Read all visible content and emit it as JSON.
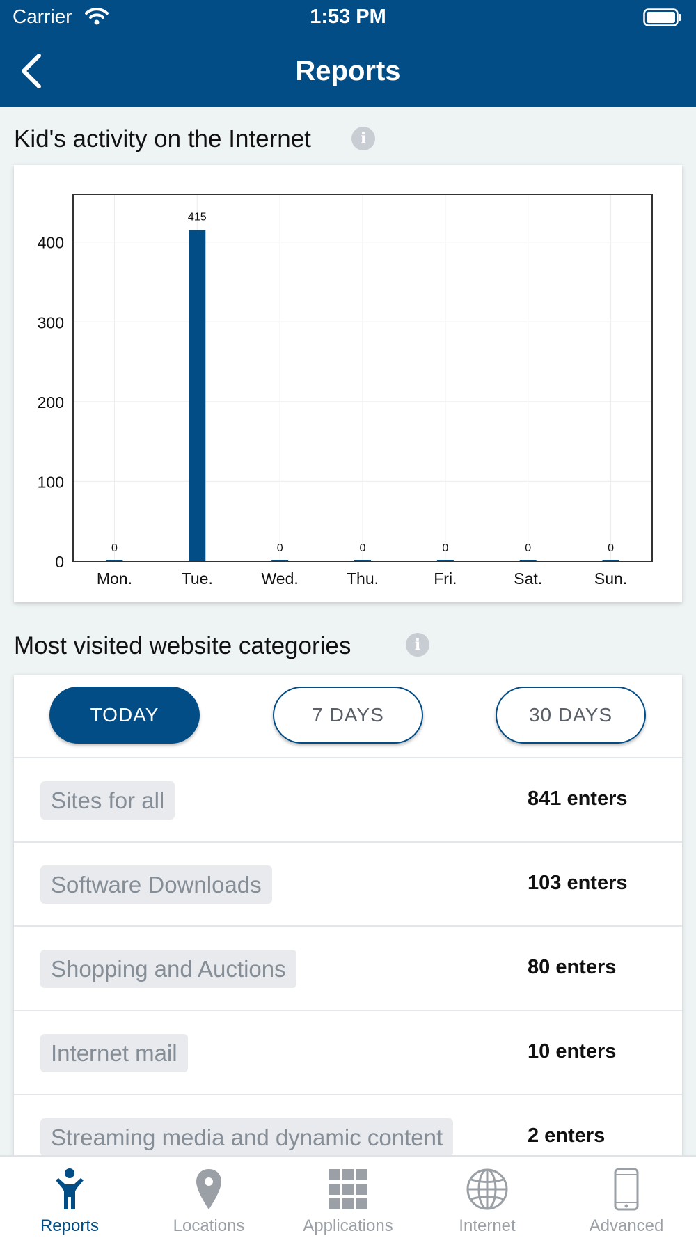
{
  "status_bar": {
    "carrier": "Carrier",
    "time": "1:53 PM"
  },
  "header": {
    "title": "Reports"
  },
  "activity": {
    "title": "Kid's activity on the Internet",
    "chart_data": {
      "type": "bar",
      "categories": [
        "Mon.",
        "Tue.",
        "Wed.",
        "Thu.",
        "Fri.",
        "Sat.",
        "Sun."
      ],
      "values": [
        0,
        415,
        0,
        0,
        0,
        0,
        0
      ],
      "data_labels": [
        "0",
        "415",
        "0",
        "0",
        "0",
        "0",
        "0"
      ],
      "yticks": [
        0,
        100,
        200,
        300,
        400
      ],
      "ylim": [
        0,
        460
      ],
      "grid": true,
      "bar_color": "#024d86"
    }
  },
  "categories_section": {
    "title": "Most visited website categories",
    "filters": [
      {
        "label": "TODAY",
        "active": true
      },
      {
        "label": "7 DAYS",
        "active": false
      },
      {
        "label": "30 DAYS",
        "active": false
      }
    ],
    "rows": [
      {
        "category": "Sites for all",
        "count": "841 enters"
      },
      {
        "category": "Software Downloads",
        "count": "103 enters"
      },
      {
        "category": "Shopping and Auctions",
        "count": "80 enters"
      },
      {
        "category": "Internet mail",
        "count": "10 enters"
      },
      {
        "category": "Streaming media and dynamic content",
        "count": "2 enters"
      }
    ]
  },
  "tabbar": {
    "tabs": [
      {
        "label": "Reports",
        "icon": "person-icon",
        "active": true
      },
      {
        "label": "Locations",
        "icon": "location-pin-icon",
        "active": false
      },
      {
        "label": "Applications",
        "icon": "grid-icon",
        "active": false
      },
      {
        "label": "Internet",
        "icon": "globe-icon",
        "active": false
      },
      {
        "label": "Advanced",
        "icon": "phone-icon",
        "active": false
      }
    ]
  },
  "colors": {
    "primary": "#024d86",
    "background": "#eef3f4",
    "chip_background": "#e8eaed",
    "inactive": "#9aa0a6"
  }
}
